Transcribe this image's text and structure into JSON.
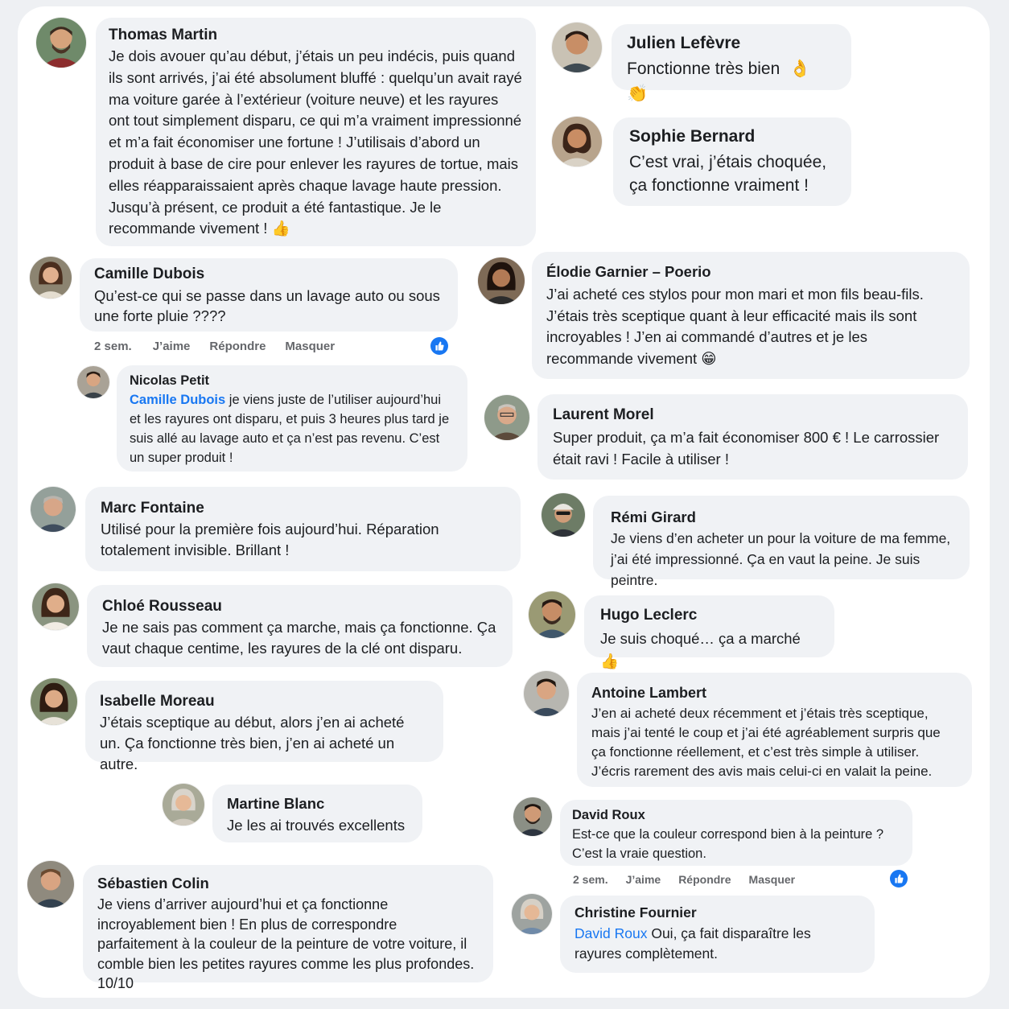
{
  "comments": [
    {
      "name": "Thomas Martin",
      "text": "Je dois avouer qu’au début, j’étais un peu indécis, puis quand ils sont arrivés, j’ai été absolument bluffé : quelqu’un avait rayé ma voiture garée à l’extérieur (voiture neuve) et les rayures ont tout simplement disparu, ce qui m’a vraiment impressionné et m’a fait économiser une fortune ! J’utilisais d’abord un produit à base de cire pour enlever les rayures de tortue, mais elles réapparaissaient après chaque lavage haute pression. Jusqu’à présent, ce produit a été fantastique. Je le recommande vivement !",
      "emoji": "👍"
    },
    {
      "name": "Julien Lefèvre",
      "text": "Fonctionne très bien",
      "emoji": "👌 👏"
    },
    {
      "name": "Sophie Bernard",
      "text": "C’est vrai, j’étais choquée, ça fonctionne vraiment !"
    },
    {
      "name": "Camille Dubois",
      "text": "Qu’est-ce qui se passe dans un lavage auto ou sous une forte pluie ????"
    },
    {
      "name": "Élodie Garnier – Poerio",
      "text": "J’ai acheté ces stylos pour mon mari et mon fils beau-fils. J’étais très sceptique quant à leur efficacité mais ils sont incroyables ! J’en ai commandé d’autres et je les recommande vivement",
      "emoji": "😁"
    },
    {
      "name": "Nicolas Petit",
      "mention": "Camille Dubois",
      "text": " je viens juste de l’utiliser aujourd’hui et les rayures ont disparu, et puis 3 heures plus tard je suis allé au lavage auto et ça n’est pas revenu. C’est un super produit !"
    },
    {
      "name": "Laurent Morel",
      "text": "Super produit, ça m’a fait économiser 800 € ! Le carrossier était ravi ! Facile à utiliser !"
    },
    {
      "name": "Marc Fontaine",
      "text": "Utilisé pour la première fois aujourd’hui. Réparation totalement invisible. Brillant !"
    },
    {
      "name": "Rémi Girard",
      "text": "Je viens d’en acheter un pour la voiture de ma femme, j’ai été impressionné. Ça en vaut la peine. Je suis peintre."
    },
    {
      "name": "Chloé Rousseau",
      "text": "Je ne sais pas comment ça marche, mais ça fonctionne. Ça vaut chaque centime, les rayures de la clé ont disparu."
    },
    {
      "name": "Hugo Leclerc",
      "text": "Je suis choqué… ça a marché",
      "emoji": "👍"
    },
    {
      "name": "Isabelle Moreau",
      "text": "J’étais sceptique au début, alors j’en ai acheté un. Ça fonctionne très bien, j’en ai acheté un autre."
    },
    {
      "name": "Antoine Lambert",
      "text": "J’en ai acheté deux récemment et j’étais très sceptique, mais j’ai tenté le coup et j’ai été agréablement surpris que ça fonctionne réellement, et c’est très simple à utiliser. J’écris rarement des avis mais celui-ci en valait la peine."
    },
    {
      "name": "Martine Blanc",
      "text": "Je les ai trouvés excellents"
    },
    {
      "name": "David Roux",
      "text": "Est-ce que la couleur correspond bien à la peinture ? C’est la vraie question."
    },
    {
      "name": "Sébastien Colin",
      "text": "Je viens d’arriver aujourd’hui et ça fonctionne incroyablement bien ! En plus de correspondre parfaitement à la couleur de la peinture de votre voiture, il comble bien les petites rayures comme les plus profondes. 10/10"
    },
    {
      "name": "Christine Fournier",
      "mention": "David Roux",
      "text": " Oui, ça fait disparaître les rayures complètement."
    }
  ],
  "actions": {
    "time": "2 sem.",
    "like": "J’aime",
    "reply": "Répondre",
    "hide": "Masquer"
  },
  "colors": {
    "bubble": "#f0f2f5",
    "mention": "#1877f2",
    "like": "#1877f2",
    "meta": "#65676b"
  }
}
